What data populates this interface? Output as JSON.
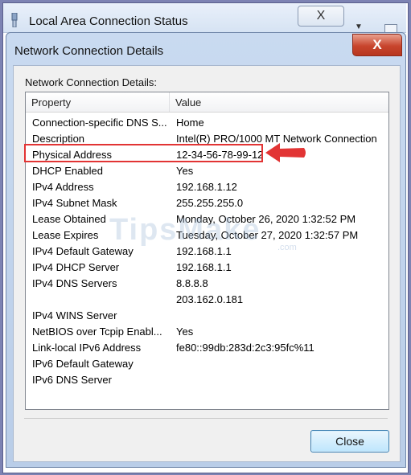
{
  "back_window": {
    "title": "Local Area Connection Status",
    "close_label": "X"
  },
  "dialog": {
    "title": "Network Connection Details",
    "close_label": "X",
    "section_label": "Network Connection Details:",
    "columns": {
      "property": "Property",
      "value": "Value"
    },
    "rows": [
      {
        "property": "Connection-specific DNS S...",
        "value": "Home"
      },
      {
        "property": "Description",
        "value": "Intel(R) PRO/1000 MT Network Connection"
      },
      {
        "property": "Physical Address",
        "value": "12-34-56-78-99-12"
      },
      {
        "property": "DHCP Enabled",
        "value": "Yes"
      },
      {
        "property": "IPv4 Address",
        "value": "192.168.1.12"
      },
      {
        "property": "IPv4 Subnet Mask",
        "value": "255.255.255.0"
      },
      {
        "property": "Lease Obtained",
        "value": "Monday, October 26, 2020 1:32:52 PM"
      },
      {
        "property": "Lease Expires",
        "value": "Tuesday, October 27, 2020 1:32:57 PM"
      },
      {
        "property": "IPv4 Default Gateway",
        "value": "192.168.1.1"
      },
      {
        "property": "IPv4 DHCP Server",
        "value": "192.168.1.1"
      },
      {
        "property": "IPv4 DNS Servers",
        "value": "8.8.8.8"
      },
      {
        "property": "",
        "value": "203.162.0.181"
      },
      {
        "property": "IPv4 WINS Server",
        "value": ""
      },
      {
        "property": "NetBIOS over Tcpip Enabl...",
        "value": "Yes"
      },
      {
        "property": "Link-local IPv6 Address",
        "value": "fe80::99db:283d:2c3:95fc%11"
      },
      {
        "property": "IPv6 Default Gateway",
        "value": ""
      },
      {
        "property": "IPv6 DNS Server",
        "value": ""
      }
    ],
    "close_button": "Close"
  },
  "watermark": {
    "main": "TipsMake",
    "sub": ".com"
  },
  "colors": {
    "highlight": "#e23434",
    "titlebar_close": "#c8452d",
    "background": "#7d83b3"
  }
}
